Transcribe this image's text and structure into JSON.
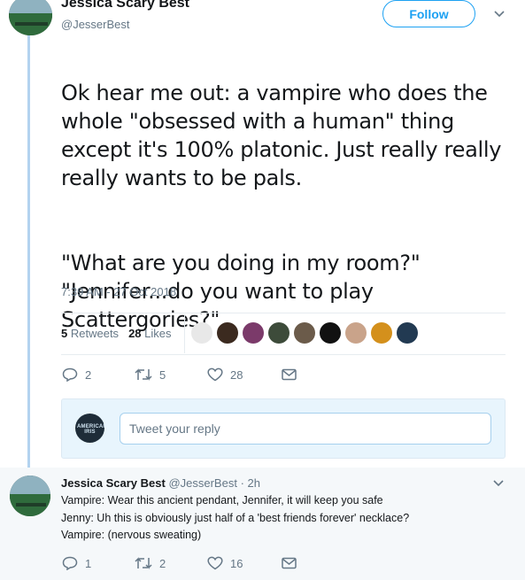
{
  "tweet": {
    "author_name": "Jessica Scary Best",
    "author_handle": "@JesserBest",
    "follow_label": "Follow",
    "text_para1": "Ok hear me out: a vampire who does the whole \"obsessed with a human\" thing except it's 100% platonic. Just really really really wants to be pals.",
    "text_para2": "\"What are you doing in my room?\"\n\"Jennifer...do you want to play Scattergories?\"",
    "timestamp": "7:39 AM - 27 Oct 2018",
    "retweets_count": "5",
    "retweets_label": "Retweets",
    "likes_count": "28",
    "likes_label": "Likes",
    "actions": {
      "replies": "2",
      "retweets": "5",
      "likes": "28"
    }
  },
  "likers": [
    {
      "icon": "liker-avatar-1",
      "color": "#e8e8e8"
    },
    {
      "icon": "liker-avatar-2",
      "color": "#3b2a1f"
    },
    {
      "icon": "liker-avatar-3",
      "color": "#7b3a6a"
    },
    {
      "icon": "liker-avatar-4",
      "color": "#3d4b3a"
    },
    {
      "icon": "liker-avatar-5",
      "color": "#6b5b4a"
    },
    {
      "icon": "liker-avatar-6",
      "color": "#111111"
    },
    {
      "icon": "liker-avatar-7",
      "color": "#c9a38a"
    },
    {
      "icon": "liker-avatar-8",
      "color": "#d4901c"
    },
    {
      "icon": "liker-avatar-9",
      "color": "#223a52"
    }
  ],
  "compose": {
    "placeholder": "Tweet your reply",
    "avatar_text": "AMERICAN IRIS"
  },
  "reply": {
    "author_name": "Jessica Scary Best",
    "author_handle": "@JesserBest",
    "separator": "·",
    "time": "2h",
    "line1": "Vampire: Wear this ancient pendant, Jennifer, it will keep you safe",
    "line2": "Jenny: Uh this is obviously just half of a 'best friends forever' necklace?",
    "line3": "Vampire: (nervous sweating)",
    "actions": {
      "replies": "1",
      "retweets": "2",
      "likes": "16"
    }
  },
  "colors": {
    "accent": "#1da1f2",
    "muted": "#657786",
    "thread_line": "#b3d3ef"
  }
}
